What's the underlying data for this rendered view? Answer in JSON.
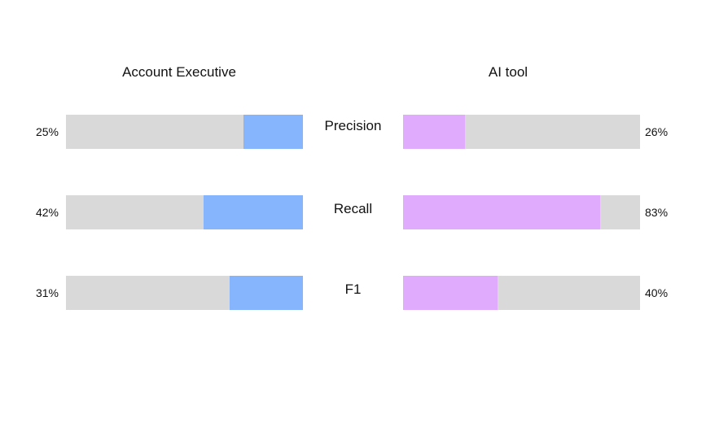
{
  "chart_data": {
    "type": "bar",
    "title": "",
    "categories": [
      "Precision",
      "Recall",
      "F1"
    ],
    "series": [
      {
        "name": "Account Executive",
        "values": [
          25,
          42,
          31
        ],
        "value_labels": [
          "25%",
          "42%",
          "31%"
        ],
        "color": "#86b5fd",
        "direction": "right-to-left"
      },
      {
        "name": "AI tool",
        "values": [
          26,
          83,
          40
        ],
        "value_labels": [
          "26%",
          "83%",
          "40%"
        ],
        "color": "#e0aafd",
        "direction": "left-to-right"
      }
    ],
    "track_color": "#d9d9d9",
    "ylim": [
      0,
      100
    ],
    "xlabel": "",
    "ylabel": "",
    "grid": false,
    "legend": "panel titles (top)"
  }
}
